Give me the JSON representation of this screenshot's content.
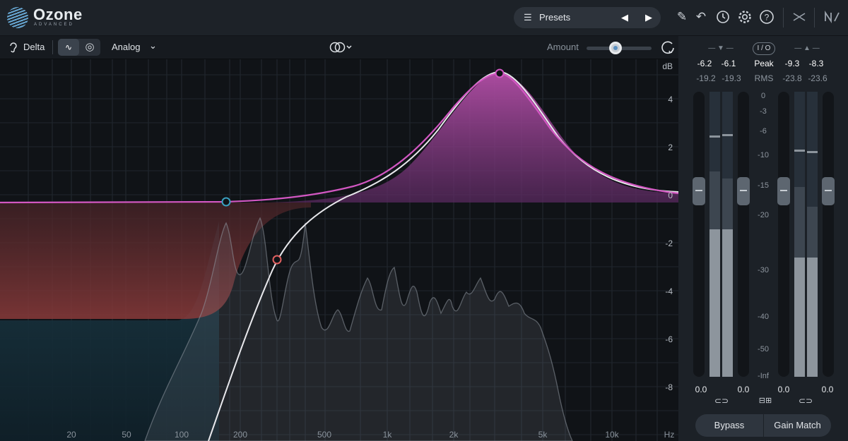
{
  "header": {
    "app_name": "Ozone",
    "app_edition": "ADVANCED",
    "presets_label": "Presets",
    "icons": [
      "list-icon",
      "prev-arrow-icon",
      "next-arrow-icon",
      "pencil-icon",
      "undo-icon",
      "history-icon",
      "gear-icon",
      "help-icon",
      "routing-icon",
      "ni-logo-icon"
    ]
  },
  "toolbar": {
    "delta_label": "Delta",
    "mode_label": "Analog",
    "amount_label": "Amount",
    "amount_value": 0.45
  },
  "eq": {
    "db_unit": "dB",
    "db_ticks": [
      "4",
      "2",
      "0",
      "-2",
      "-4",
      "-6",
      "-8"
    ],
    "hz_unit": "Hz",
    "freq_ticks": [
      "20",
      "50",
      "100",
      "200",
      "500",
      "1k",
      "2k",
      "5k",
      "10k"
    ],
    "accent_colors": {
      "magenta": "#c44fb0",
      "red": "#c0504f",
      "teal": "#3aa0c0",
      "curve": "#e6e6ea"
    }
  },
  "meters": {
    "input": {
      "peak_l": "-6.2",
      "peak_r": "-6.1",
      "rms_l": "-19.2",
      "rms_r": "-19.3",
      "gain_l": "0.0",
      "gain_r": "0.0"
    },
    "output": {
      "peak_l": "-9.3",
      "peak_r": "-8.3",
      "rms_l": "-23.8",
      "rms_r": "-23.6",
      "gain_l": "0.0",
      "gain_r": "0.0"
    },
    "io_label": "I / O",
    "peak_label": "Peak",
    "rms_label": "RMS",
    "scale": [
      "0",
      "-3",
      "-6",
      "-10",
      "-15",
      "-20",
      "-30",
      "-40",
      "-50",
      "-Inf"
    ],
    "bypass_label": "Bypass",
    "gain_match_label": "Gain Match"
  }
}
